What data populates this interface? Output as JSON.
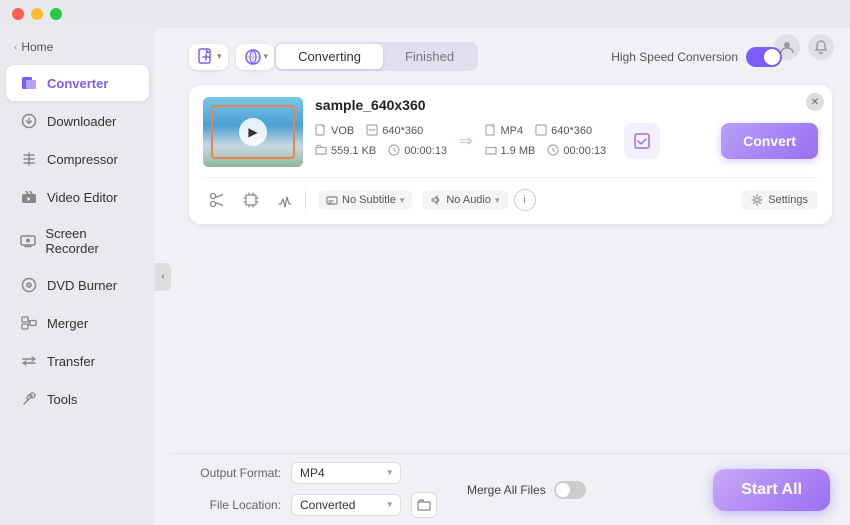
{
  "titlebar": {
    "btn_close": "close",
    "btn_min": "minimize",
    "btn_max": "maximize"
  },
  "sidebar": {
    "home_label": "Home",
    "items": [
      {
        "id": "converter",
        "label": "Converter",
        "icon": "⬛",
        "active": true
      },
      {
        "id": "downloader",
        "label": "Downloader",
        "icon": "⬇"
      },
      {
        "id": "compressor",
        "label": "Compressor",
        "icon": "🗜"
      },
      {
        "id": "video-editor",
        "label": "Video Editor",
        "icon": "✂"
      },
      {
        "id": "screen-recorder",
        "label": "Screen Recorder",
        "icon": "⏺"
      },
      {
        "id": "dvd-burner",
        "label": "DVD Burner",
        "icon": "💿"
      },
      {
        "id": "merger",
        "label": "Merger",
        "icon": "⧉"
      },
      {
        "id": "transfer",
        "label": "Transfer",
        "icon": "↔"
      },
      {
        "id": "tools",
        "label": "Tools",
        "icon": "🔧"
      }
    ]
  },
  "header": {
    "add_file_label": "add-file",
    "add_url_label": "add-url",
    "tabs": [
      {
        "id": "converting",
        "label": "Converting",
        "active": true
      },
      {
        "id": "finished",
        "label": "Finished",
        "active": false
      }
    ],
    "hsc_label": "High Speed Conversion",
    "hsc_on": true
  },
  "file_card": {
    "name": "sample_640x360",
    "source": {
      "format": "VOB",
      "resolution": "640*360",
      "size": "559.1 KB",
      "duration": "00:00:13"
    },
    "output": {
      "format": "MP4",
      "resolution": "640*360",
      "size": "1.9 MB",
      "duration": "00:00:13"
    },
    "subtitle": "No Subtitle",
    "audio": "No Audio",
    "convert_label": "Convert",
    "settings_label": "Settings"
  },
  "bottom": {
    "output_format_label": "Output Format:",
    "output_format_value": "MP4",
    "file_location_label": "File Location:",
    "file_location_value": "Converted",
    "merge_all_label": "Merge All Files",
    "start_all_label": "Start All"
  },
  "top_icons": {
    "user_icon": "👤",
    "bell_icon": "🔔"
  }
}
